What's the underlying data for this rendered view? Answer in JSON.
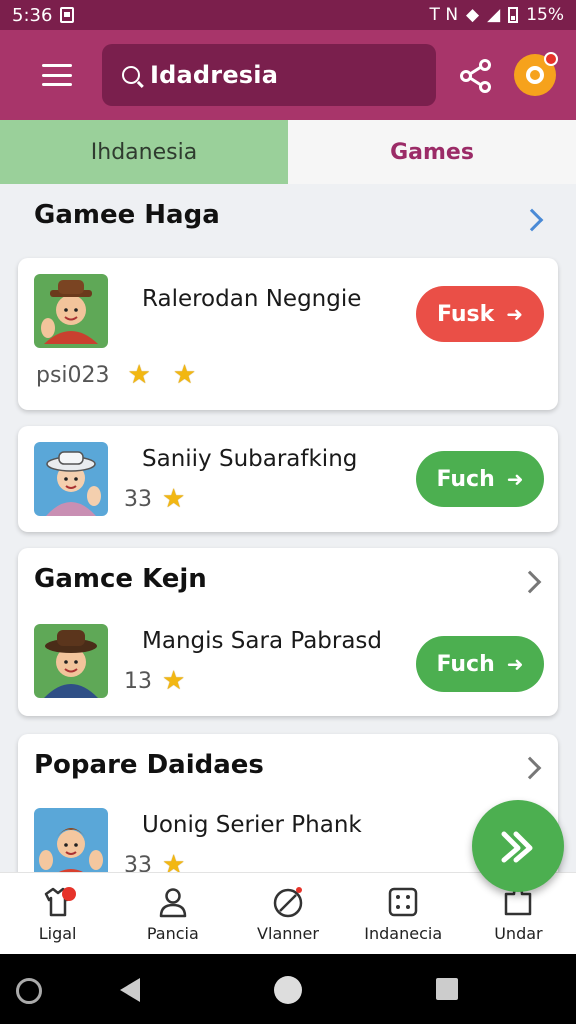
{
  "status_bar": {
    "time": "5:36",
    "right_text": "T N",
    "battery": "15%"
  },
  "app_bar": {
    "search_text": "Idadresia"
  },
  "tabs": [
    {
      "label": "Ihdanesia"
    },
    {
      "label": "Games"
    }
  ],
  "sections": [
    {
      "title": "Gamee Haga",
      "items": [
        {
          "title": "Ralerodan Negngie",
          "meta": "psi023",
          "stars": 2,
          "button": "Fusk",
          "button_color": "#ea4f47"
        },
        {
          "title": "Saniiy Subarafking",
          "meta": "33",
          "stars": 1,
          "button": "Fuch",
          "button_color": "#4caf50"
        }
      ]
    },
    {
      "title": "Gamce Kejn",
      "items": [
        {
          "title": "Mangis Sara Pabrasd",
          "meta": "13",
          "stars": 1,
          "button": "Fuch",
          "button_color": "#4caf50"
        }
      ]
    },
    {
      "title": "Popare Daidaes",
      "items": [
        {
          "title": "Uonig Serier Phank",
          "meta": "33",
          "stars": 1
        }
      ]
    }
  ],
  "bottom_nav": [
    {
      "label": "Ligal",
      "icon": "shirt-icon"
    },
    {
      "label": "Pancia",
      "icon": "person-icon"
    },
    {
      "label": "Vlanner",
      "icon": "compass-icon"
    },
    {
      "label": "Indanecia",
      "icon": "dice-icon"
    },
    {
      "label": "Undar",
      "icon": "puzzle-icon"
    }
  ],
  "colors": {
    "header": "#a8356a",
    "status": "#7b1f4c",
    "accent_green": "#4caf50",
    "accent_red": "#ea4f47",
    "tab_active": "#9ad09a"
  }
}
